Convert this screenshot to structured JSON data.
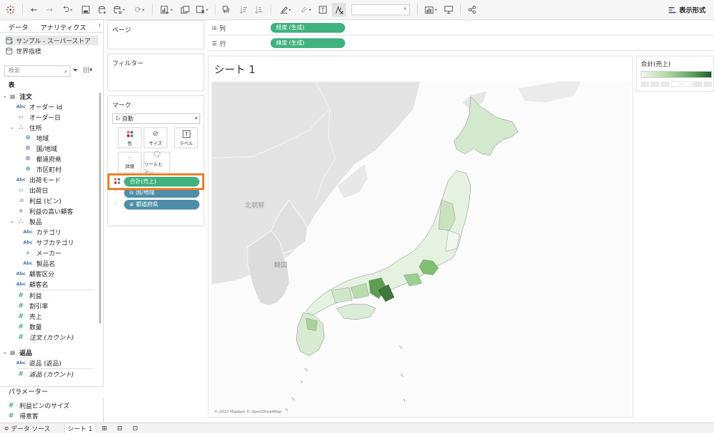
{
  "toolbar": {
    "show_me_label": "表示形式"
  },
  "data_pane": {
    "tabs": [
      "データ",
      "アナリティクス"
    ],
    "datasources": [
      "サンプル - スーパーストア",
      "世界指標"
    ],
    "search_placeholder": "検索",
    "section_label": "表",
    "tables": [
      {
        "name": "注文"
      },
      {
        "name": "返品"
      }
    ],
    "fields": {
      "order_id": "オーダー Id",
      "order_date": "オーダー日",
      "address": "住所",
      "region": "地域",
      "country": "国/地域",
      "prefecture": "都道府県",
      "city": "市区町村",
      "ship_mode": "出荷モード",
      "ship_date": "出荷日",
      "profit_bin": "利益 (ビン)",
      "top_customers": "利益の高い顧客",
      "product": "製品",
      "category": "カテゴリ",
      "subcategory": "サブカテゴリ",
      "maker": "メーカー",
      "product_name": "製品名",
      "segment": "顧客区分",
      "customer_name": "顧客名",
      "profit": "利益",
      "discount": "割引率",
      "sales": "売上",
      "quantity": "数量",
      "order_count": "注文 (カウント)",
      "returned": "返品 (返品)",
      "return_count": "返品 (カウント)",
      "param_profit_bin": "利益ビンのサイズ",
      "param_top": "得意客"
    },
    "parameters_label": "パラメーター"
  },
  "cards": {
    "pages": "ページ",
    "filters": "フィルター",
    "marks": "マーク",
    "mark_type": "自動",
    "mark_buttons": [
      "色",
      "サイズ",
      "ラベル",
      "詳細",
      "ツールヒン..."
    ],
    "mark_pills": [
      "合計(売上)",
      "国/地域",
      "都道府県"
    ]
  },
  "shelves": {
    "columns_label": "列",
    "columns_pill": "経度 (生成)",
    "rows_label": "行",
    "rows_pill": "緯度 (生成)"
  },
  "sheet": {
    "title": "シート 1",
    "map_labels": [
      "北朝鮮",
      "韓国"
    ],
    "attribution": "© 2022 Mapbox © OpenStreetMap"
  },
  "legend": {
    "title": "合計(売上)"
  },
  "bottom_tabs": [
    "データ ソース",
    "シート 1"
  ],
  "colors": {
    "measure_pill": "#3fb27f",
    "dimension_pill": "#4f8ea8",
    "highlight": "#ee7d22"
  }
}
